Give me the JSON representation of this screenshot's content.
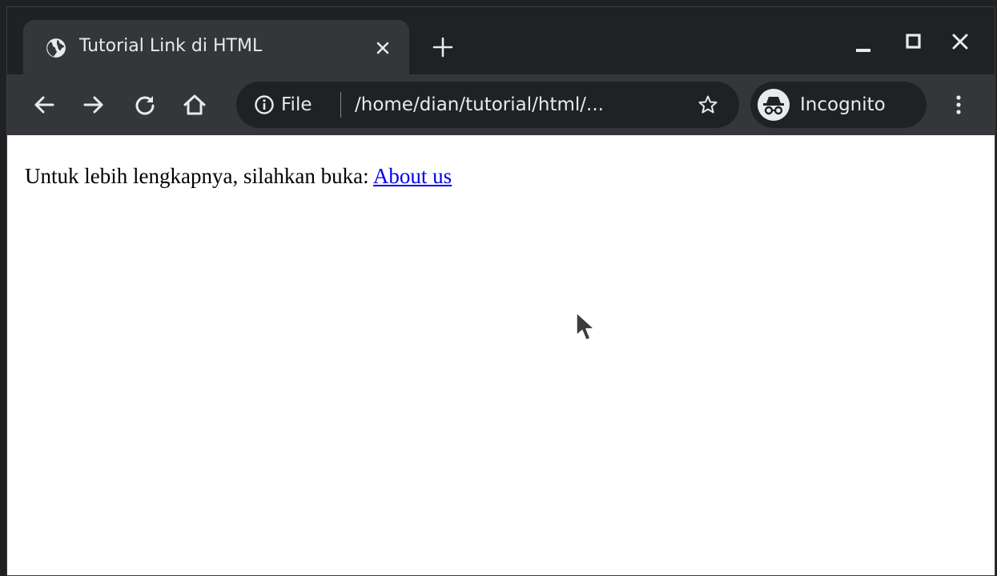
{
  "tab": {
    "title": "Tutorial Link di HTML",
    "favicon_icon": "globe-icon",
    "close_icon": "close-icon"
  },
  "newtab_icon": "plus-icon",
  "window_controls": [
    "minimize-icon",
    "maximize-icon",
    "close-icon"
  ],
  "toolbar": {
    "back_icon": "back-arrow-icon",
    "forward_icon": "forward-arrow-icon",
    "reload_icon": "reload-icon",
    "home_icon": "home-icon",
    "omnibox": {
      "info_icon": "info-icon",
      "scheme_label": "File",
      "url": "/home/dian/tutorial/html/...",
      "bookmark_icon": "star-icon"
    },
    "incognito": {
      "icon": "incognito-icon",
      "label": "Incognito"
    },
    "menu_icon": "kebab-menu-icon"
  },
  "content": {
    "text": "Untuk lebih lengkapnya, silahkan buka: ",
    "link_text": "About us"
  },
  "colors": {
    "frame": "#202124",
    "toolbar": "#35363a",
    "link": "#0000ee",
    "text_light": "#e8eaed"
  }
}
